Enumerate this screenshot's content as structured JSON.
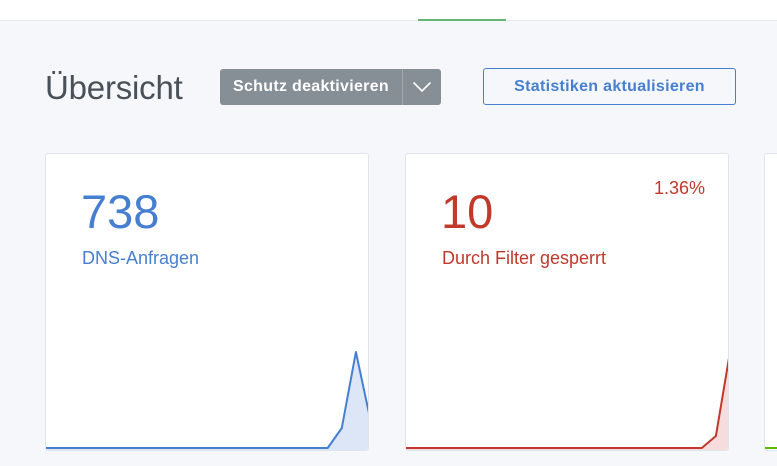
{
  "header": {
    "title": "Übersicht"
  },
  "toolbar": {
    "protection_button_label": "Schutz deaktivieren",
    "dropdown_icon": "chevron-down-icon",
    "refresh_button_label": "Statistiken aktualisieren"
  },
  "cards": [
    {
      "value": "738",
      "label": "DNS-Anfragen",
      "color": "#467fcf",
      "fill": "#dde6f6",
      "spark": [
        0,
        0,
        0,
        0,
        0,
        0,
        0,
        0,
        0,
        0,
        0,
        0,
        0,
        0,
        0,
        0,
        0,
        0,
        0,
        0,
        0,
        20,
        96,
        30
      ]
    },
    {
      "value": "10",
      "percent": "1.36%",
      "label": "Durch Filter gesperrt",
      "color": "#c0392b",
      "fill": "#f6dcdc",
      "spark": [
        0,
        0,
        0,
        0,
        0,
        0,
        0,
        0,
        0,
        0,
        0,
        0,
        0,
        0,
        0,
        0,
        0,
        0,
        0,
        0,
        0,
        0,
        12,
        96
      ]
    },
    {
      "color": "#5eba00"
    }
  ],
  "colors": {
    "accent_blue": "#467fcf",
    "danger_red": "#c0392b",
    "secondary_gray": "#868e96",
    "success_green": "#5eba00"
  }
}
